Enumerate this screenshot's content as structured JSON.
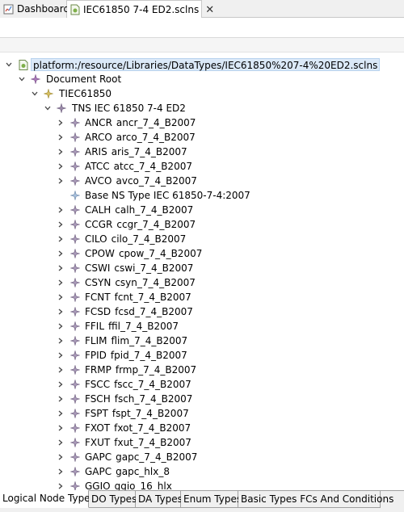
{
  "editor_tabs": [
    {
      "label": "Dashboard",
      "icon": "dashboard-icon",
      "active": false
    },
    {
      "label": "IEC61850 7-4 ED2.sclns",
      "icon": "sclns-file-icon",
      "active": true,
      "closable": true
    }
  ],
  "tree": {
    "resource": "platform:/resource/Libraries/DataTypes/IEC61850%207-4%20ED2.sclns",
    "document_root": "Document Root",
    "tiec": "TIEC61850",
    "tns": "TNS IEC 61850 7-4 ED2",
    "items": [
      {
        "name": "ANCR",
        "id": "ancr_7_4_B2007",
        "expandable": true
      },
      {
        "name": "ARCO",
        "id": "arco_7_4_B2007",
        "expandable": true
      },
      {
        "name": "ARIS",
        "id": "aris_7_4_B2007",
        "expandable": true
      },
      {
        "name": "ATCC",
        "id": "atcc_7_4_B2007",
        "expandable": true
      },
      {
        "name": "AVCO",
        "id": "avco_7_4_B2007",
        "expandable": true
      },
      {
        "name": "Base NS Type IEC 61850-7-4:2007",
        "id": "",
        "expandable": false
      },
      {
        "name": "CALH",
        "id": "calh_7_4_B2007",
        "expandable": true
      },
      {
        "name": "CCGR",
        "id": "ccgr_7_4_B2007",
        "expandable": true
      },
      {
        "name": "CILO",
        "id": "cilo_7_4_B2007",
        "expandable": true
      },
      {
        "name": "CPOW",
        "id": "cpow_7_4_B2007",
        "expandable": true
      },
      {
        "name": "CSWI",
        "id": "cswi_7_4_B2007",
        "expandable": true
      },
      {
        "name": "CSYN",
        "id": "csyn_7_4_B2007",
        "expandable": true
      },
      {
        "name": "FCNT",
        "id": "fcnt_7_4_B2007",
        "expandable": true
      },
      {
        "name": "FCSD",
        "id": "fcsd_7_4_B2007",
        "expandable": true
      },
      {
        "name": "FFIL",
        "id": "ffil_7_4_B2007",
        "expandable": true
      },
      {
        "name": "FLIM",
        "id": "flim_7_4_B2007",
        "expandable": true
      },
      {
        "name": "FPID",
        "id": "fpid_7_4_B2007",
        "expandable": true
      },
      {
        "name": "FRMP",
        "id": "frmp_7_4_B2007",
        "expandable": true
      },
      {
        "name": "FSCC",
        "id": "fscc_7_4_B2007",
        "expandable": true
      },
      {
        "name": "FSCH",
        "id": "fsch_7_4_B2007",
        "expandable": true
      },
      {
        "name": "FSPT",
        "id": "fspt_7_4_B2007",
        "expandable": true
      },
      {
        "name": "FXOT",
        "id": "fxot_7_4_B2007",
        "expandable": true
      },
      {
        "name": "FXUT",
        "id": "fxut_7_4_B2007",
        "expandable": true
      },
      {
        "name": "GAPC",
        "id": "gapc_7_4_B2007",
        "expandable": true
      },
      {
        "name": "GAPC",
        "id": "gapc_hlx_8",
        "expandable": true
      },
      {
        "name": "GGIO",
        "id": "ggio_16_hlx",
        "expandable": true
      }
    ]
  },
  "bottom_tabs": [
    {
      "label": "Logical Node Types",
      "active": true
    },
    {
      "label": "DO Types",
      "active": false
    },
    {
      "label": "DA Types",
      "active": false
    },
    {
      "label": "Enum Types",
      "active": false
    },
    {
      "label": "Basic Types FCs And Conditions",
      "active": false
    }
  ],
  "colors": {
    "node_icon_purple": "#a87ab8",
    "node_icon_gray": "#9a8aa8",
    "tiec_icon": "#c8b460",
    "base_ns_icon": "#8fa8c8",
    "selection_bg": "#dbe9f8"
  }
}
